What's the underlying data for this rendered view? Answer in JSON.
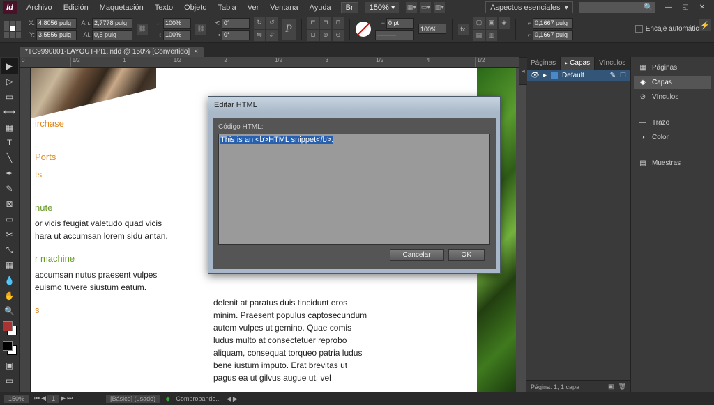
{
  "app": {
    "logo_text": "Id"
  },
  "menu": [
    "Archivo",
    "Edición",
    "Maquetación",
    "Texto",
    "Objeto",
    "Tabla",
    "Ver",
    "Ventana",
    "Ayuda"
  ],
  "top": {
    "br_label": "Br",
    "zoom": "150%",
    "workspace": "Aspectos esenciales",
    "search_placeholder": ""
  },
  "controlbar": {
    "x": "4,8056 pulg",
    "y": "3,5556 pulg",
    "w": "2,7778 pulg",
    "h": "0,5 pulg",
    "sx": "100%",
    "sy": "100%",
    "rot": "0°",
    "shear": "0°",
    "stroke_w": "0 pt",
    "stroke_pct": "100%",
    "fx_w": "0,1667 pulg",
    "fx_h": "0,1667 pulg",
    "auto_fit": "Encaje automático"
  },
  "tab": {
    "title": "*TC9990801-LAYOUT-PI1.indd @ 150% [Convertido]"
  },
  "ruler_ticks": [
    "0",
    "1/2",
    "1",
    "1/2",
    "2",
    "1/2",
    "3",
    "1/2",
    "4",
    "1/2"
  ],
  "doc": {
    "h1": "irchase",
    "h2": "Ports",
    "h3": "ts",
    "h4": "nute",
    "p1a": "or vicis feugiat valetudo quad vicis",
    "p1b": "hara ut accumsan lorem sidu antan.",
    "h5": "r machine",
    "p2a": "accumsan nutus praesent vulpes",
    "p2b": "euismo tuvere siustum eatum.",
    "h6": "s",
    "c2a": "delenit at paratus duis tincidunt eros",
    "c2b": "minim. Praesent populus captosecundum",
    "c2c": "autem vulpes ut gemino. Quae comis",
    "c2d": "ludus multo at consectetuer reprobo",
    "c2e": "aliquam, consequat torqueo patria ludus",
    "c2f": "bene iustum imputo. Erat brevitas ut",
    "c2g": "pagus ea ut gilvus augue ut, vel"
  },
  "panel": {
    "tabs": [
      "Páginas",
      "Capas",
      "Vínculos"
    ],
    "layer_name": "Default",
    "status": "Página: 1, 1 capa"
  },
  "sidebar": [
    {
      "icon": "▦",
      "label": "Páginas"
    },
    {
      "icon": "◈",
      "label": "Capas"
    },
    {
      "icon": "⊘",
      "label": "Vínculos"
    },
    {
      "icon": "—",
      "label": "Trazo"
    },
    {
      "icon": "◑",
      "label": "Color"
    },
    {
      "icon": "▤",
      "label": "Muestras"
    }
  ],
  "dialog": {
    "title": "Editar HTML",
    "label": "Código HTML:",
    "text": "This is an <b>HTML snippet</b>.",
    "cancel": "Cancelar",
    "ok": "OK"
  },
  "status": {
    "zoom": "150%",
    "page_nav": "1",
    "preflight": "[Básico] (usado)",
    "checking": "Comprobando..."
  }
}
